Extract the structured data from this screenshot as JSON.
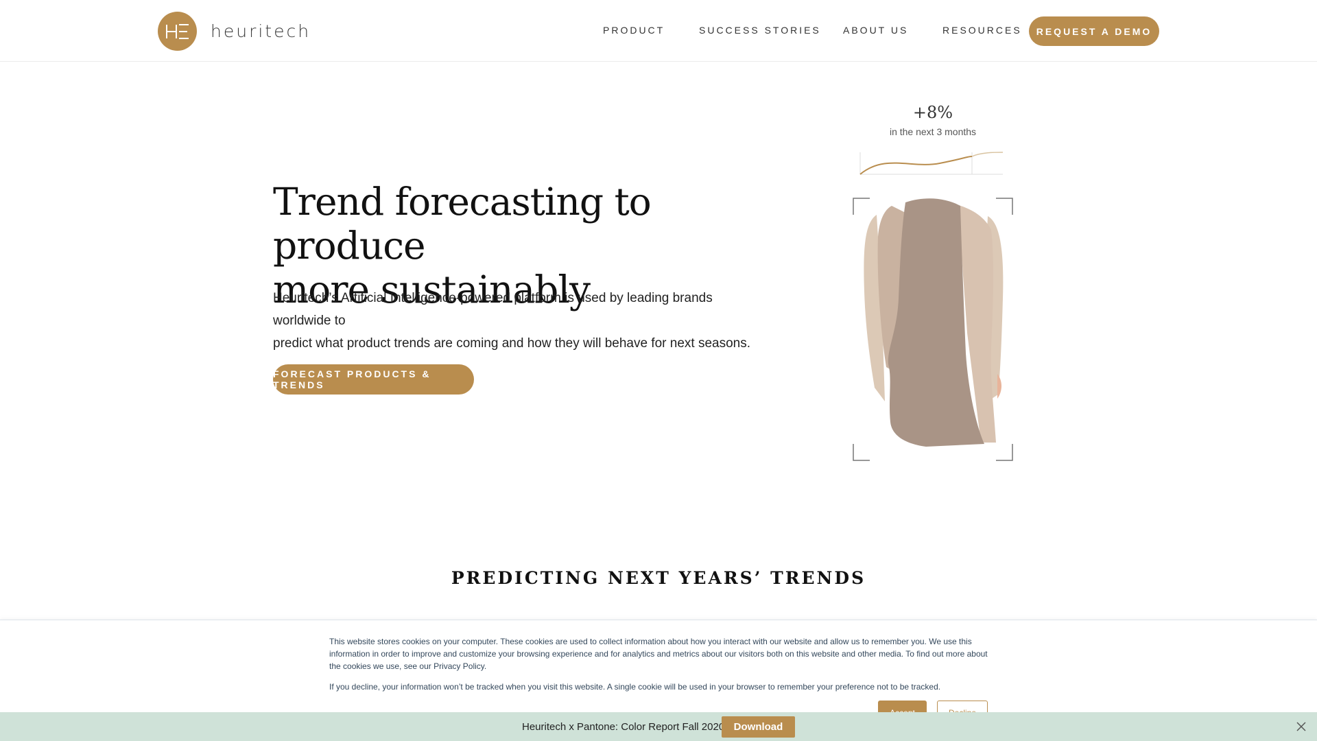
{
  "header": {
    "logo_text": "heuritech",
    "logo_icon": "heuritech-logo-icon",
    "nav": [
      {
        "label": "PRODUCT"
      },
      {
        "label": "SUCCESS STORIES"
      },
      {
        "label": "ABOUT US"
      },
      {
        "label": "RESOURCES"
      }
    ],
    "demo_button": "REQUEST A DEMO"
  },
  "hero": {
    "title_line1": "Trend forecasting to produce",
    "title_line2": "more sustainably",
    "description_line1": "Heuritech’s Artificial Intelligence-powered platform is used by leading brands worldwide to",
    "description_line2": "predict what product trends are coming and how they will behave for next seasons.",
    "cta": "FORECAST PRODUCTS & TRENDS"
  },
  "illustration": {
    "growth": "+8%",
    "growth_caption": "in the next 3 months",
    "garment_icon": "blazer-illustration"
  },
  "section": {
    "title": "PREDICTING NEXT YEARS’ TRENDS"
  },
  "cookie": {
    "text1_line1": "This website stores cookies on your computer. These cookies are used to collect information about how you interact with our website and allow us to remember you. We use this",
    "text1_line2": "information in order to improve and customize your browsing experience and for analytics and metrics about our visitors both on this website and other media. To find out more about",
    "text1_line3": "the cookies we use, see our Privacy Policy.",
    "text2": "If you decline, your information won’t be tracked when you visit this website. A single cookie will be used in your browser to remember your preference not to be tracked.",
    "accept": "Accept",
    "decline": "Decline"
  },
  "promo": {
    "text": "Heuritech x Pantone: Color Report Fall 2020",
    "button": "Download",
    "close_icon": "close-icon"
  },
  "colors": {
    "accent": "#b98d4e",
    "promo_bg": "#cfe2d8",
    "cookie_text": "#33475b"
  }
}
